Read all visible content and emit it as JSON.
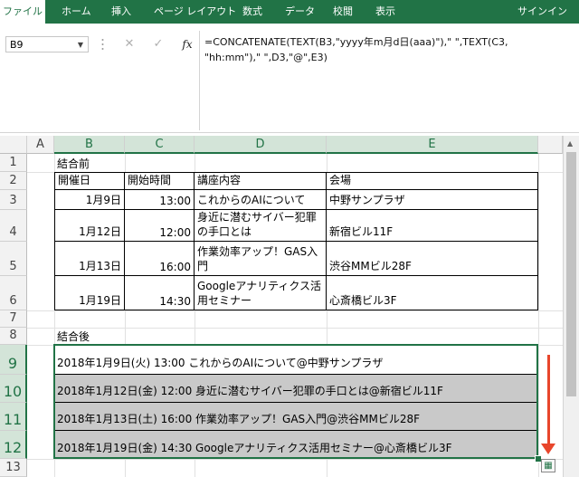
{
  "ribbon": {
    "tabs": [
      "ファイル",
      "ホーム",
      "挿入",
      "ページ レイアウト",
      "数式",
      "データ",
      "校閲",
      "表示"
    ],
    "signin": "サインイン"
  },
  "formula_bar": {
    "name_box": "B9",
    "fx_label": "fx",
    "formula_lines": [
      "=CONCATENATE(TEXT(B3,\"yyyy年m月d日(aaa)\"),\" \",TEXT(C3,",
      "\"hh:mm\"),\" \",D3,\"@\",E3)"
    ]
  },
  "columns": [
    "A",
    "B",
    "C",
    "D",
    "E"
  ],
  "rows": [
    "1",
    "2",
    "3",
    "4",
    "5",
    "6",
    "7",
    "8",
    "9",
    "10",
    "11",
    "12",
    "13"
  ],
  "before_label": "結合前",
  "after_label": "結合後",
  "table": {
    "headers": [
      "開催日",
      "開始時間",
      "講座内容",
      "会場"
    ],
    "rows": [
      {
        "date": "1月9日",
        "time": "13:00",
        "topic": "これからのAIについて",
        "venue": "中野サンプラザ"
      },
      {
        "date": "1月12日",
        "time": "12:00",
        "topic": "身近に潜むサイバー犯罪の手口とは",
        "venue": "新宿ビル11F"
      },
      {
        "date": "1月13日",
        "time": "16:00",
        "topic": "作業効率アップ！GAS入門",
        "venue": "渋谷MMビル28F"
      },
      {
        "date": "1月19日",
        "time": "14:30",
        "topic": "Googleアナリティクス活用セミナー",
        "venue": "心斎橋ビル3F"
      }
    ]
  },
  "results": [
    "2018年1月9日(火) 13:00 これからのAIについて@中野サンプラザ",
    "2018年1月12日(金) 12:00 身近に潜むサイバー犯罪の手口とは@新宿ビル11F",
    "2018年1月13日(土) 16:00 作業効率アップ！GAS入門@渋谷MMビル28F",
    "2018年1月19日(金) 14:30 Googleアナリティクス活用セミナー@心斎橋ビル3F"
  ],
  "colors": {
    "accent": "#217346",
    "arrow": "#e8462c",
    "fill_gray": "#c9c9c9"
  }
}
